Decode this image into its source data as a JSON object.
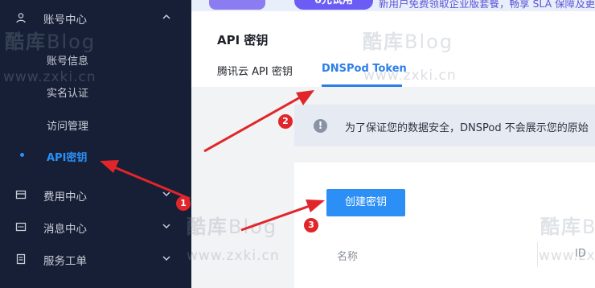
{
  "banner": {
    "badge": "6元试用",
    "text": "新用户免费领取企业版套餐，畅享 SLA 保障及更多"
  },
  "sidebar": {
    "groups": [
      {
        "label": "账号中心",
        "icon": "user-icon",
        "expanded": true
      },
      {
        "label": "费用中心",
        "icon": "billing-icon",
        "expanded": false
      },
      {
        "label": "消息中心",
        "icon": "message-icon",
        "expanded": false
      },
      {
        "label": "服务工单",
        "icon": "ticket-icon",
        "expanded": false
      }
    ],
    "account_items": [
      {
        "label": "账号信息",
        "active": false
      },
      {
        "label": "实名认证",
        "active": false
      },
      {
        "label": "访问管理",
        "active": false
      },
      {
        "label": "API密钥",
        "active": true
      }
    ]
  },
  "header": {
    "title": "API 密钥",
    "tabs": [
      {
        "label": "腾讯云 API 密钥",
        "active": false
      },
      {
        "label": "DNSPod Token",
        "active": true
      }
    ]
  },
  "notice": {
    "text": "为了保证您的数据安全，DNSPod 不会展示您的原始"
  },
  "card": {
    "create_button": "创建密钥",
    "columns": [
      "名称",
      "ID"
    ]
  },
  "watermark": {
    "title_cn": "酷库",
    "title_en": "Blog",
    "url": "www.zxki.cn"
  },
  "annotations": [
    "1",
    "2",
    "3"
  ],
  "colors": {
    "sidebar_bg": "#161f35",
    "accent": "#2b8ff5",
    "annotation_red": "#e0262a"
  }
}
